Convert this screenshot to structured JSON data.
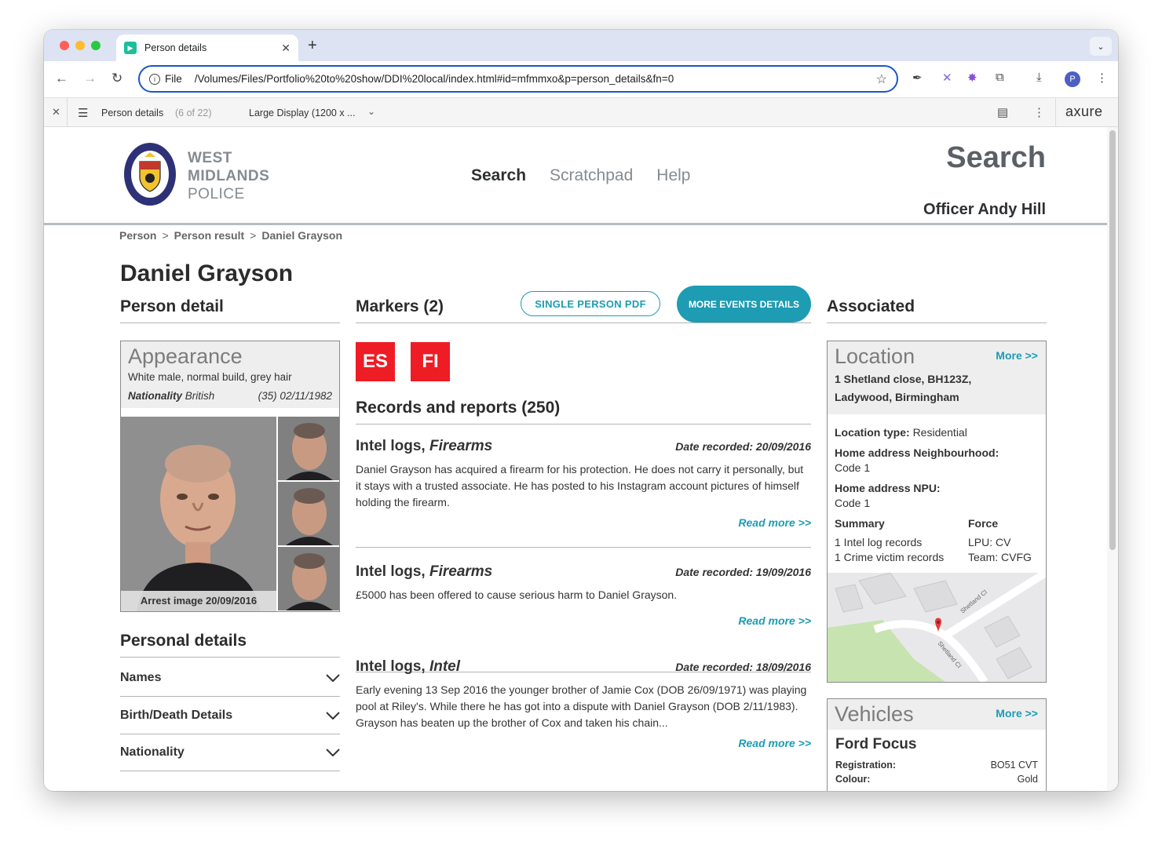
{
  "browser": {
    "tab_title": "Person details",
    "omnibox_scheme": "File",
    "url": "/Volumes/Files/Portfolio%20to%20show/DDI%20local/index.html#id=mfmmxo&p=person_details&fn=0",
    "profile_initial": "P"
  },
  "axure": {
    "page_name": "Person details",
    "page_count": "(6 of 22)",
    "display": "Large Display (1200 x ...",
    "logo": "axure"
  },
  "header": {
    "logo_line1": "WEST",
    "logo_line2": "MIDLANDS",
    "logo_line3": "POLICE",
    "nav": [
      "Search",
      "Scratchpad",
      "Help"
    ],
    "page_heading": "Search",
    "officer": "Officer Andy Hill"
  },
  "breadcrumb": [
    "Person",
    "Person result",
    "Daniel Grayson"
  ],
  "person": {
    "name": "Daniel Grayson",
    "detail_title": "Person detail",
    "appearance_title": "Appearance",
    "appearance_desc": "White male, normal build, grey hair",
    "nationality_label": "Nationality",
    "nationality_value": "British",
    "age_dob": "(35) 02/11/1982",
    "arrest_caption": "Arrest image 20/09/2016"
  },
  "personal_details": {
    "title": "Personal details",
    "sections": [
      "Names",
      "Birth/Death Details",
      "Nationality"
    ]
  },
  "markers": {
    "title": "Markers (2)",
    "pdf_button": "SINGLE PERSON PDF",
    "events_button": "MORE EVENTS DETAILS",
    "codes": [
      "ES",
      "FI"
    ],
    "color": "#ee1c25"
  },
  "records": {
    "title": "Records and reports (250)",
    "items": [
      {
        "type": "Intel logs,",
        "subtype": "Firearms",
        "date": "Date recorded: 20/09/2016",
        "body": "Daniel Grayson has acquired a firearm for his protection. He does not carry it personally, but it stays with a trusted associate. He has posted to his Instagram account pictures of himself holding the firearm.",
        "more": "Read more >>"
      },
      {
        "type": "Intel logs,",
        "subtype": "Firearms",
        "date": "Date recorded: 19/09/2016",
        "body": "£5000 has been offered to cause serious harm to Daniel Grayson.",
        "more": "Read more >>"
      },
      {
        "type": "Intel logs,",
        "subtype": "Intel",
        "date": "Date recorded: 18/09/2016",
        "body": "Early evening 13 Sep 2016 the younger brother of Jamie Cox (DOB 26/09/1971) was playing pool at Riley's. While there he has got into a dispute with Daniel Grayson (DOB 2/11/1983). Grayson has beaten up the brother of Cox and taken his chain...",
        "more": "Read more >>"
      }
    ]
  },
  "associated": {
    "title": "Associated",
    "location": {
      "title": "Location",
      "more": "More >>",
      "address_line1": "1 Shetland close, BH123Z,",
      "address_line2": "Ladywood, Birmingham",
      "type_label": "Location type:",
      "type_value": "Residential",
      "neighbourhood_label": "Home address Neighbourhood:",
      "neighbourhood_value": "Code 1",
      "npu_label": "Home address NPU:",
      "npu_value": "Code 1",
      "summary_label": "Summary",
      "force_label": "Force",
      "summary_items": [
        "1 Intel log records",
        "1 Crime victim records"
      ],
      "force_items": [
        "LPU: CV",
        "Team: CVFG"
      ],
      "map_street_1": "Shetland Cl",
      "map_street_2": "Shetland Cl"
    },
    "vehicles": {
      "title": "Vehicles",
      "more": "More >>",
      "name": "Ford Focus",
      "registration_label": "Registration:",
      "registration_value": "BO51 CVT",
      "colour_label": "Colour:",
      "colour_value": "Gold"
    }
  },
  "colors": {
    "accent": "#1d9cb3",
    "marker_red": "#ee1c25"
  }
}
